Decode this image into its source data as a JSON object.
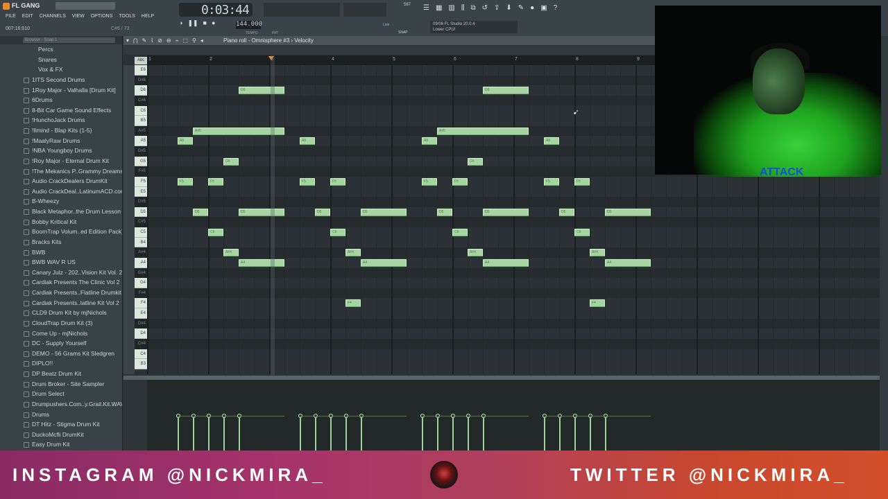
{
  "app": {
    "name": "FL GANG",
    "song_position": "007:16:010",
    "top_numbers": "C#6 / 73"
  },
  "menu": [
    "FILE",
    "EDIT",
    "CHANNELS",
    "VIEW",
    "OPTIONS",
    "TOOLS",
    "HELP"
  ],
  "transport": {
    "time": "0:03:44",
    "tempo": "144.000",
    "tempo_label": "TEMPO",
    "pat_label": "PAT",
    "cpu": "587",
    "play_icons": [
      "play-icon",
      "stop-icon",
      "record-icon"
    ]
  },
  "hint": {
    "line1": "09/06  FL Studio 20.0.4",
    "line2": "Lower CPU!",
    "snap_mode": "Line",
    "snap_label": "SNAP"
  },
  "browser": {
    "search_placeholder": "Browser - Snap 1",
    "items": [
      {
        "label": "Percs",
        "indent": 2
      },
      {
        "label": "Snares",
        "indent": 2
      },
      {
        "label": "Vox & FX",
        "indent": 2
      },
      {
        "label": "1ITS Second Drums",
        "indent": 1
      },
      {
        "label": "1Roy Major - Valhalla [Drum Kit]",
        "indent": 1
      },
      {
        "label": "6Drums",
        "indent": 1
      },
      {
        "label": "8-Bit Car Game Sound Effects",
        "indent": 1
      },
      {
        "label": "!HunchoJack Drums",
        "indent": 1
      },
      {
        "label": "!Ilmind - Blap Kits (1-5)",
        "indent": 1
      },
      {
        "label": "!MaalyRaw Drums",
        "indent": 1
      },
      {
        "label": "!NBA Youngboy Drums",
        "indent": 1
      },
      {
        "label": "!Roy Major - Eternal Drum Kit",
        "indent": 1
      },
      {
        "label": "!The Mekanics P..Grammy Dreams",
        "indent": 1
      },
      {
        "label": "Audio CrackDealers DrumKit",
        "indent": 1
      },
      {
        "label": "Audio CrackDeal..LatinumACD.com]",
        "indent": 1
      },
      {
        "label": "B-Wheezy",
        "indent": 1
      },
      {
        "label": "Black Metaphor..the Drum Lesson",
        "indent": 1
      },
      {
        "label": "Bobby Kritical Kit",
        "indent": 1
      },
      {
        "label": "BoomTrap Volum..ed Edition Pack)",
        "indent": 1
      },
      {
        "label": "Bracks Kits",
        "indent": 1
      },
      {
        "label": "BWB",
        "indent": 1
      },
      {
        "label": "BWB WAV R US",
        "indent": 1
      },
      {
        "label": "Canary Julz - 202..Vision Kit Vol. 2",
        "indent": 1
      },
      {
        "label": "Cardiak Presents The Clinic Vol 2",
        "indent": 1
      },
      {
        "label": "Cardiak Presents..Flatline Drumkit",
        "indent": 1
      },
      {
        "label": "Cardiak Presents..latline Kit Vol 2",
        "indent": 1
      },
      {
        "label": "CLD9 Drum Kit by mjNichols",
        "indent": 1
      },
      {
        "label": "CloudTrap Drum Kit (3)",
        "indent": 1
      },
      {
        "label": "Come Up - mjNichols",
        "indent": 1
      },
      {
        "label": "DC - Supply Yourself",
        "indent": 1
      },
      {
        "label": "DEMO - 56 Grams Kit Sledgren",
        "indent": 1
      },
      {
        "label": "DIPLO!!",
        "indent": 1
      },
      {
        "label": "DP Beatz Drum Kit",
        "indent": 1
      },
      {
        "label": "Drum Broker - Site Sampler",
        "indent": 1
      },
      {
        "label": "Drum Select",
        "indent": 1
      },
      {
        "label": "Drumpushers.Com..y.Grail.Kit.WAV",
        "indent": 1
      },
      {
        "label": "Drums",
        "indent": 1
      },
      {
        "label": "DT Hitz - Stigma Drum Kit",
        "indent": 1
      },
      {
        "label": "DuckoMcfli DrumKit",
        "indent": 1
      },
      {
        "label": "Easy Drum Kit",
        "indent": 1
      }
    ]
  },
  "piano_roll": {
    "title": "Piano roll - Omnisphere #3",
    "view_target": "Velocity",
    "abc_label": "Abc",
    "bars": [
      "1",
      "2",
      "3",
      "4",
      "5",
      "6",
      "7",
      "8",
      "9"
    ],
    "keys": [
      "E6",
      "D#6",
      "D6",
      "C#6",
      "C6",
      "B5",
      "A#5",
      "A5",
      "G#5",
      "G5",
      "F#5",
      "F5",
      "E5",
      "D#5",
      "D5",
      "C#5",
      "C5",
      "B4",
      "A#4",
      "A4",
      "G#4",
      "G4",
      "F#4",
      "F4",
      "E4",
      "D#4",
      "D4",
      "C#4",
      "C4",
      "B3"
    ],
    "notes": [
      {
        "key": "D6",
        "start": 2.25,
        "len": 0.75
      },
      {
        "key": "D6",
        "start": 6.25,
        "len": 0.75
      },
      {
        "key": "A#5",
        "start": 1.5,
        "len": 1.5
      },
      {
        "key": "A#5",
        "start": 5.5,
        "len": 1.5
      },
      {
        "key": "A5",
        "start": 1.25,
        "len": 0.25
      },
      {
        "key": "A5",
        "start": 3.25,
        "len": 0.25
      },
      {
        "key": "A5",
        "start": 5.25,
        "len": 0.25
      },
      {
        "key": "A5",
        "start": 7.25,
        "len": 0.25
      },
      {
        "key": "G5",
        "start": 2.0,
        "len": 0.25
      },
      {
        "key": "G5",
        "start": 6.0,
        "len": 0.25
      },
      {
        "key": "F5",
        "start": 1.25,
        "len": 0.25
      },
      {
        "key": "F5",
        "start": 1.75,
        "len": 0.25
      },
      {
        "key": "F5",
        "start": 3.25,
        "len": 0.25
      },
      {
        "key": "F5",
        "start": 3.75,
        "len": 0.25
      },
      {
        "key": "F5",
        "start": 5.25,
        "len": 0.25
      },
      {
        "key": "F5",
        "start": 5.75,
        "len": 0.25
      },
      {
        "key": "F5",
        "start": 7.25,
        "len": 0.25
      },
      {
        "key": "F5",
        "start": 7.75,
        "len": 0.25
      },
      {
        "key": "D5",
        "start": 1.5,
        "len": 0.25
      },
      {
        "key": "D5",
        "start": 2.25,
        "len": 0.75
      },
      {
        "key": "D5",
        "start": 3.5,
        "len": 0.25
      },
      {
        "key": "D5",
        "start": 4.25,
        "len": 0.75
      },
      {
        "key": "D5",
        "start": 5.5,
        "len": 0.25
      },
      {
        "key": "D5",
        "start": 6.25,
        "len": 0.75
      },
      {
        "key": "D5",
        "start": 7.5,
        "len": 0.25
      },
      {
        "key": "D5",
        "start": 8.25,
        "len": 0.75
      },
      {
        "key": "C5",
        "start": 1.75,
        "len": 0.25
      },
      {
        "key": "C5",
        "start": 3.75,
        "len": 0.25
      },
      {
        "key": "C5",
        "start": 5.75,
        "len": 0.25
      },
      {
        "key": "C5",
        "start": 7.75,
        "len": 0.25
      },
      {
        "key": "A#4",
        "start": 2.0,
        "len": 0.25
      },
      {
        "key": "A#4",
        "start": 4.0,
        "len": 0.25
      },
      {
        "key": "A#4",
        "start": 6.0,
        "len": 0.25
      },
      {
        "key": "A#4",
        "start": 8.0,
        "len": 0.25
      },
      {
        "key": "A4",
        "start": 2.25,
        "len": 0.75
      },
      {
        "key": "A4",
        "start": 4.25,
        "len": 0.75
      },
      {
        "key": "A4",
        "start": 6.25,
        "len": 0.75
      },
      {
        "key": "A4",
        "start": 8.25,
        "len": 0.75
      },
      {
        "key": "F4",
        "start": 4.0,
        "len": 0.25
      },
      {
        "key": "F4",
        "start": 8.0,
        "len": 0.25
      }
    ]
  },
  "webcam": {
    "shirt_text": "ATTACK"
  },
  "banner": {
    "instagram": "INSTAGRAM @NICKMIRA_",
    "twitter": "TWITTER @NICKMIRA_",
    "colors": {
      "start": "#8a2b64",
      "end": "#d44e2a"
    }
  },
  "colors": {
    "note": "#a5d6a2",
    "playhead": "#ff9e2a",
    "background": "#2b3236"
  }
}
